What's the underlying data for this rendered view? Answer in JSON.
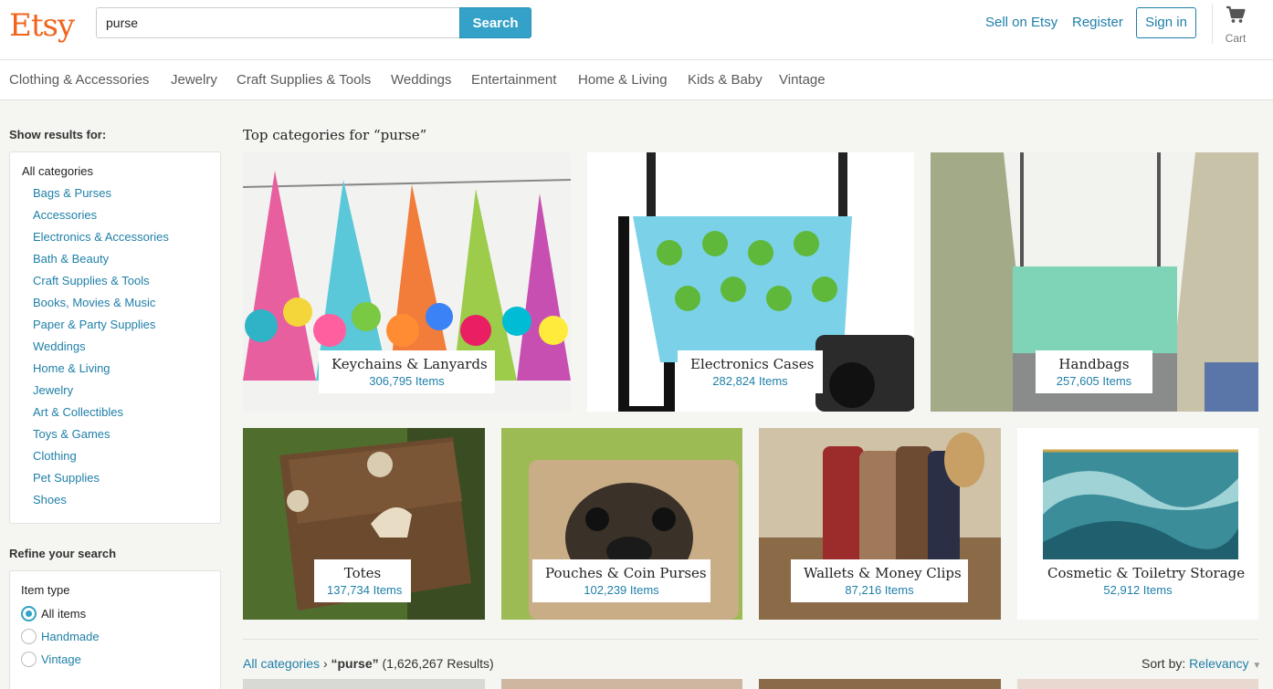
{
  "header": {
    "logo": "Etsy",
    "search_value": "purse",
    "search_button": "Search",
    "sell_link": "Sell on Etsy",
    "register_link": "Register",
    "signin_button": "Sign in",
    "cart_label": "Cart",
    "cart_icon": "shopping-cart-icon"
  },
  "nav": {
    "items": [
      "Clothing & Accessories",
      "Jewelry",
      "Craft Supplies & Tools",
      "Weddings",
      "Entertainment",
      "Home & Living",
      "Kids & Baby",
      "Vintage"
    ]
  },
  "sidebar": {
    "show_results_title": "Show results for:",
    "all_categories": "All categories",
    "categories": [
      "Bags & Purses",
      "Accessories",
      "Electronics & Accessories",
      "Bath & Beauty",
      "Craft Supplies & Tools",
      "Books, Movies & Music",
      "Paper & Party Supplies",
      "Weddings",
      "Home & Living",
      "Jewelry",
      "Art & Collectibles",
      "Toys & Games",
      "Clothing",
      "Pet Supplies",
      "Shoes"
    ],
    "refine_title": "Refine your search",
    "item_type_label": "Item type",
    "item_types": [
      "All items",
      "Handmade",
      "Vintage"
    ],
    "item_type_selected": "All items"
  },
  "main": {
    "title": "Top categories for “purse”",
    "tiles": [
      {
        "name": "Keychains & Lanyards",
        "count": "306,795 Items"
      },
      {
        "name": "Electronics Cases",
        "count": "282,824 Items"
      },
      {
        "name": "Handbags",
        "count": "257,605 Items"
      },
      {
        "name": "Totes",
        "count": "137,734 Items"
      },
      {
        "name": "Pouches & Coin Purses",
        "count": "102,239 Items"
      },
      {
        "name": "Wallets & Money Clips",
        "count": "87,216 Items"
      },
      {
        "name": "Cosmetic & Toiletry Storage",
        "count": "52,912 Items"
      }
    ],
    "results": {
      "crumb": "All categories",
      "query": "“purse”",
      "count": "(1,626,267 Results)"
    },
    "sort": {
      "label": "Sort by:",
      "value": "Relevancy"
    }
  }
}
